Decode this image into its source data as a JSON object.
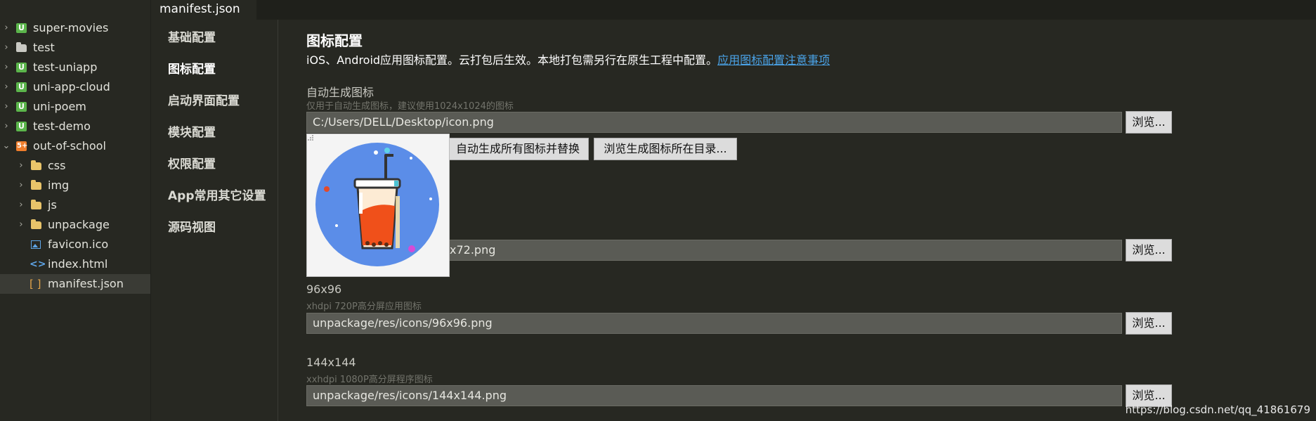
{
  "explorer": {
    "items": [
      {
        "label": "super-movies",
        "icon": "uniapp-icon",
        "expanded": false
      },
      {
        "label": "test",
        "icon": "folder-icon",
        "expanded": false
      },
      {
        "label": "test-uniapp",
        "icon": "uniapp-icon",
        "expanded": false
      },
      {
        "label": "uni-app-cloud",
        "icon": "uniapp-icon",
        "expanded": false
      },
      {
        "label": "uni-poem",
        "icon": "uniapp-icon",
        "expanded": false
      },
      {
        "label": "test-demo",
        "icon": "uniapp-icon",
        "expanded": false
      },
      {
        "label": "out-of-school",
        "icon": "html5plus-icon",
        "expanded": true
      },
      {
        "label": "css",
        "icon": "folder-icon",
        "expanded": false
      },
      {
        "label": "img",
        "icon": "folder-icon",
        "expanded": false
      },
      {
        "label": "js",
        "icon": "folder-icon",
        "expanded": false
      },
      {
        "label": "unpackage",
        "icon": "folder-icon",
        "expanded": false
      },
      {
        "label": "favicon.ico",
        "icon": "image-file-icon"
      },
      {
        "label": "index.html",
        "icon": "code-file-icon"
      },
      {
        "label": "manifest.json",
        "icon": "json-file-icon",
        "selected": true
      }
    ]
  },
  "tabs": [
    {
      "label": "manifest.json",
      "active": true
    }
  ],
  "settings_nav": {
    "items": [
      "基础配置",
      "图标配置",
      "启动界面配置",
      "模块配置",
      "权限配置",
      "App常用其它设置",
      "源码视图"
    ],
    "active_index": 1
  },
  "main": {
    "title": "图标配置",
    "description": "iOS、Android应用图标配置。云打包后生效。本地打包需另行在原生工程中配置。",
    "description_link": "应用图标配置注意事项",
    "auto_icon": {
      "label": "自动生成图标",
      "hint": "仅用于自动生成图标，建议使用1024x1024的图标",
      "value": "C:/Users/DELL/Desktop/icon.png",
      "browse_label": "浏览...",
      "generate_label": "自动生成所有图标并替换",
      "open_dir_label": "浏览生成图标所在目录..."
    },
    "icon_72": {
      "value_visible": "x72.png",
      "browse_label": "浏览..."
    },
    "icon_96": {
      "label": "96x96",
      "hint": "xhdpi 720P高分屏应用图标",
      "value": "unpackage/res/icons/96x96.png",
      "browse_label": "浏览..."
    },
    "icon_144": {
      "label": "144x144",
      "hint": "xxhdpi 1080P高分屏程序图标",
      "value": "unpackage/res/icons/144x144.png",
      "browse_label": "浏览..."
    }
  },
  "watermark": "https://blog.csdn.net/qq_41861679",
  "colors": {
    "background": "#272822",
    "accent_link": "#4aa3e8",
    "preview_circle": "#5b8de8",
    "drink_fill": "#f0501a"
  }
}
